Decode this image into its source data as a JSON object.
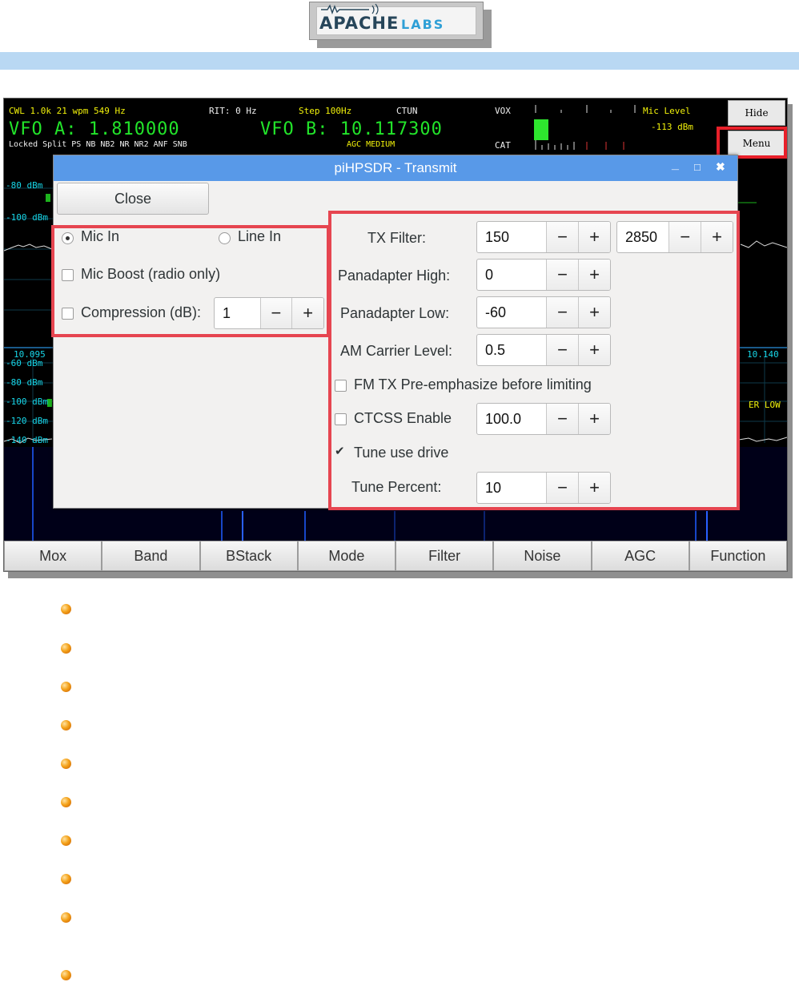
{
  "header": {
    "logo_primary": "APACHE",
    "logo_secondary": "LABS"
  },
  "radio": {
    "status_line1": {
      "mode": "CWL 1.0k 21 wpm 549 Hz",
      "rit": "RIT: 0 Hz",
      "step": "Step 100Hz",
      "ctun": "CTUN",
      "vox": "VOX",
      "mic_level_label": "Mic Level",
      "mic_level_value": "-113 dBm"
    },
    "vfo_a": "VFO A: 1.810000",
    "vfo_b": "VFO B: 10.117300",
    "status_line3": {
      "flags": "Locked Split  PS    NB  NB2 NR  NR2 ANF SNB",
      "agc": "AGC MEDIUM",
      "cat": "CAT"
    },
    "side_buttons": {
      "hide": "Hide",
      "menu": "Menu"
    },
    "panadapter_labels": {
      "top_80": "-80 dBm",
      "top_100": "-100 dBm",
      "lower_freq_left": "10.095",
      "lower_freq_right": "10.140",
      "lower_60": "-60 dBm",
      "lower_80": "-80 dBm",
      "lower_100": "-100 dBm",
      "lower_120": "-120 dBm",
      "lower_140": "-140 dBm",
      "right_tag": "ER LOW"
    },
    "bottom_buttons": [
      "Mox",
      "Band",
      "BStack",
      "Mode",
      "Filter",
      "Noise",
      "AGC",
      "Function"
    ]
  },
  "dialog": {
    "title": "piHPSDR - Transmit",
    "window_buttons": {
      "minimize": "_",
      "maximize": "□",
      "close": "✖"
    },
    "close_button": "Close",
    "left_panel": {
      "mic_in": {
        "label": "Mic In",
        "selected": true
      },
      "line_in": {
        "label": "Line In",
        "selected": false
      },
      "mic_boost": {
        "label": "Mic Boost (radio only)",
        "checked": false
      },
      "compression": {
        "label": "Compression (dB):",
        "checked": false,
        "value": "1"
      }
    },
    "right_panel": {
      "tx_filter": {
        "label": "TX Filter:",
        "low": "150",
        "high": "2850"
      },
      "pan_high": {
        "label": "Panadapter High:",
        "value": "0"
      },
      "pan_low": {
        "label": "Panadapter Low:",
        "value": "-60"
      },
      "am_carrier": {
        "label": "AM Carrier Level:",
        "value": "0.5"
      },
      "fm_preemph": {
        "label": "FM TX Pre-emphasize before limiting",
        "checked": false
      },
      "ctcss": {
        "label": "CTCSS Enable",
        "checked": false,
        "value": "100.0"
      },
      "tune_drive": {
        "label": "Tune use drive",
        "checked": true
      },
      "tune_percent": {
        "label": "Tune Percent:",
        "value": "10"
      }
    },
    "minus": "−",
    "plus": "+"
  },
  "colors": {
    "highlight_red": "#e64550",
    "titlebar_blue": "#5899e8",
    "vfo_green": "#22e42a",
    "status_yellow": "#f1f10a",
    "scale_cyan": "#17d5e6",
    "band_blue": "#b9d8f3"
  },
  "bullets": {
    "count": 10,
    "icon": "orange-ball-bullet-icon"
  }
}
